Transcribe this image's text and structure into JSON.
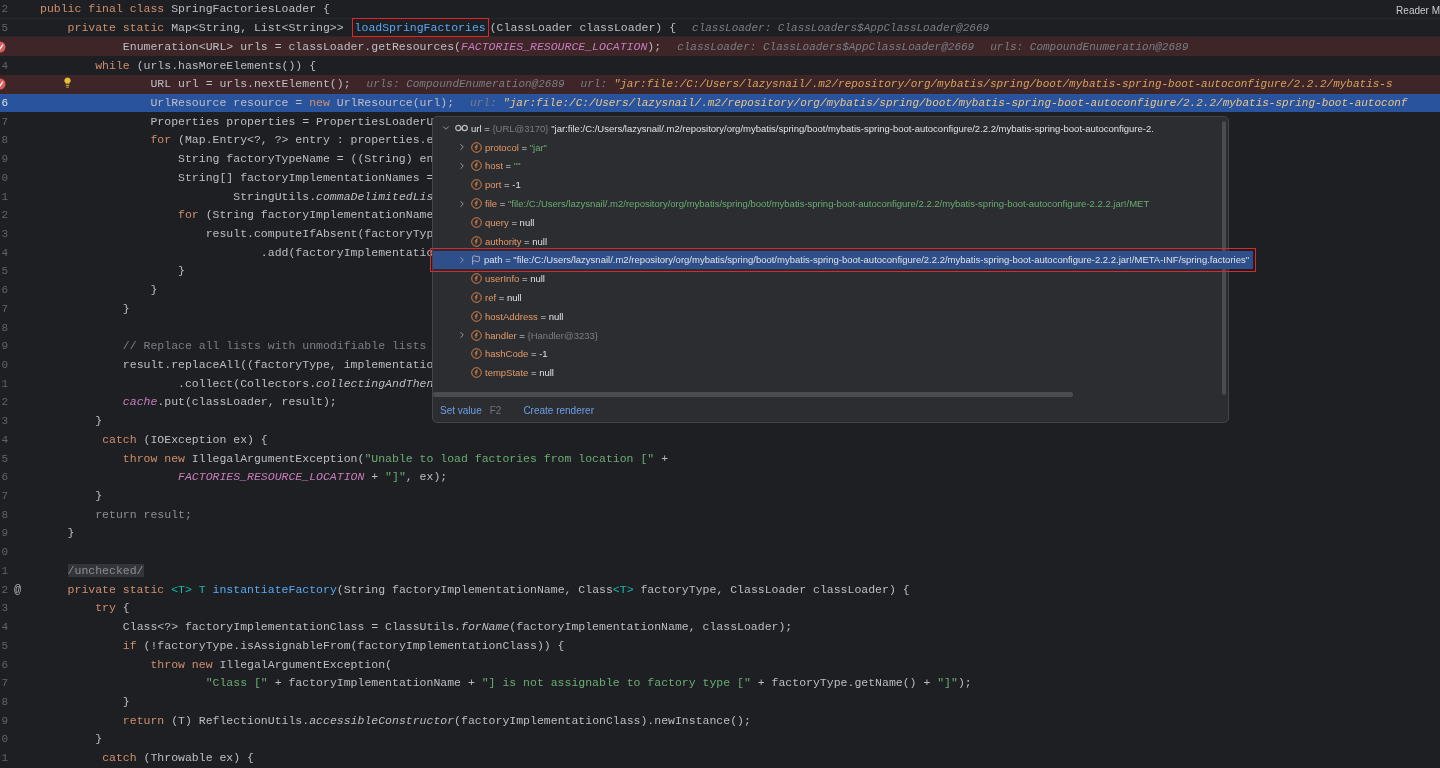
{
  "reader_mode": "Reader M",
  "lines": [
    {
      "num": "2",
      "kind": "header",
      "tokens": [
        {
          "kind": "k",
          "s": "public final class "
        },
        {
          "kind": "p",
          "s": "SpringFactoriesLoader {"
        }
      ]
    },
    {
      "num": "5",
      "kind": "header",
      "tokens": [
        {
          "kind": "k",
          "s": "    private static "
        },
        {
          "kind": "p",
          "s": "Map<String, List<String>> "
        },
        {
          "kind": "m",
          "s": "loadSpringFactories",
          "boxed": true
        },
        {
          "kind": "p",
          "s": "(ClassLoader classLoader) {"
        }
      ],
      "hints": [
        {
          "label": "classLoader: ClassLoaders$AppClassLoader@2669"
        }
      ]
    },
    {
      "kind": "breakpoint",
      "tokens": [
        {
          "kind": "p",
          "s": "            Enumeration<URL> urls = classLoader.getResources("
        },
        {
          "kind": "c",
          "s": "FACTORIES_RESOURCE_LOCATION"
        },
        {
          "kind": "p",
          "s": ");"
        }
      ],
      "hints": [
        {
          "label": "classLoader: ClassLoaders$AppClassLoader@2669"
        },
        {
          "label": "urls: CompoundEnumeration@2689"
        }
      ]
    },
    {
      "num": "4",
      "kind": "normal",
      "tokens": [
        {
          "kind": "k",
          "s": "        while "
        },
        {
          "kind": "p",
          "s": "(urls.hasMoreElements()) {"
        }
      ]
    },
    {
      "kind": "breakpoint",
      "bulb": true,
      "tokens": [
        {
          "kind": "p",
          "s": "                URL url = urls.nextElement();"
        }
      ],
      "hints": [
        {
          "label": "urls: CompoundEnumeration@2689"
        },
        {
          "label": "url: ",
          "value": "\"jar:file:/C:/Users/lazysnail/.m2/repository/org/mybatis/spring/boot/mybatis-spring-boot-autoconfigure/2.2.2/mybatis-s"
        }
      ]
    },
    {
      "num": "6",
      "kind": "current",
      "tokens": [
        {
          "kind": "p",
          "s": "                UrlResource resource = "
        },
        {
          "kind": "k",
          "s": "new "
        },
        {
          "kind": "p",
          "s": "UrlResource(url);"
        }
      ],
      "hints": [
        {
          "label": "url: ",
          "value": "\"jar:file:/C:/Users/lazysnail/.m2/repository/org/mybatis/spring/boot/mybatis-spring-boot-autoconfigure/2.2.2/mybatis-spring-boot-autoconf"
        }
      ]
    },
    {
      "num": "7",
      "kind": "normal",
      "tokens": [
        {
          "kind": "p",
          "s": "                Properties properties = PropertiesLoaderU"
        }
      ]
    },
    {
      "num": "8",
      "kind": "normal",
      "tokens": [
        {
          "kind": "k",
          "s": "                for "
        },
        {
          "kind": "p",
          "s": "(Map.Entry<?, ?> entry : properties.e"
        }
      ]
    },
    {
      "num": "9",
      "kind": "normal",
      "tokens": [
        {
          "kind": "p",
          "s": "                    String factoryTypeName = ((String) en"
        }
      ]
    },
    {
      "num": "0",
      "kind": "normal",
      "tokens": [
        {
          "kind": "p",
          "s": "                    String[] factoryImplementationNames ="
        }
      ]
    },
    {
      "num": "1",
      "kind": "normal",
      "tokens": [
        {
          "kind": "p",
          "s": "                            StringUtils."
        },
        {
          "kind": "i",
          "s": "commaDelimitedLis"
        }
      ]
    },
    {
      "num": "2",
      "kind": "normal",
      "tokens": [
        {
          "kind": "k",
          "s": "                    for "
        },
        {
          "kind": "p",
          "s": "(String factoryImplementationName"
        }
      ]
    },
    {
      "num": "3",
      "kind": "normal",
      "tokens": [
        {
          "kind": "p",
          "s": "                        result.computeIfAbsent(factoryTyp"
        }
      ]
    },
    {
      "num": "4",
      "kind": "normal",
      "tokens": [
        {
          "kind": "p",
          "s": "                                .add(factoryImplementatio"
        }
      ]
    },
    {
      "num": "5",
      "kind": "normal",
      "tokens": [
        {
          "kind": "p",
          "s": "                    }"
        }
      ]
    },
    {
      "num": "6",
      "kind": "normal",
      "tokens": [
        {
          "kind": "p",
          "s": "                }"
        }
      ]
    },
    {
      "num": "7",
      "kind": "normal",
      "tokens": [
        {
          "kind": "p",
          "s": "            }"
        }
      ]
    },
    {
      "num": "8",
      "kind": "normal"
    },
    {
      "num": "9",
      "kind": "normal",
      "tokens": [
        {
          "kind": "cm",
          "s": "            // Replace all lists with unmodifiable lists"
        }
      ]
    },
    {
      "num": "0",
      "kind": "normal",
      "tokens": [
        {
          "kind": "p",
          "s": "            result.replaceAll((factoryType, implementatio"
        }
      ]
    },
    {
      "num": "1",
      "kind": "normal",
      "tokens": [
        {
          "kind": "p",
          "s": "                    .collect(Collectors."
        },
        {
          "kind": "i",
          "s": "collectingAndThen"
        }
      ]
    },
    {
      "num": "2",
      "kind": "normal",
      "tokens": [
        {
          "kind": "f",
          "s": "            cache"
        },
        {
          "kind": "p",
          "s": ".put(classLoader, result);"
        }
      ]
    },
    {
      "num": "3",
      "kind": "normal",
      "tokens": [
        {
          "kind": "p",
          "s": "        }"
        }
      ]
    },
    {
      "num": "4",
      "kind": "normal",
      "tokens": [
        {
          "kind": "k",
          "s": "         catch "
        },
        {
          "kind": "p",
          "s": "(IOException ex) {"
        }
      ]
    },
    {
      "num": "5",
      "kind": "normal",
      "tokens": [
        {
          "kind": "k",
          "s": "            throw new "
        },
        {
          "kind": "p",
          "s": "IllegalArgumentException("
        },
        {
          "kind": "s",
          "s": "\"Unable to load factories from location [\""
        },
        {
          "kind": "p",
          "s": " +"
        }
      ]
    },
    {
      "num": "6",
      "kind": "normal",
      "tokens": [
        {
          "kind": "c",
          "s": "                    FACTORIES_RESOURCE_LOCATION"
        },
        {
          "kind": "p",
          "s": " + "
        },
        {
          "kind": "s",
          "s": "\"]\""
        },
        {
          "kind": "p",
          "s": ", ex);"
        }
      ]
    },
    {
      "num": "7",
      "kind": "normal",
      "tokens": [
        {
          "kind": "p",
          "s": "        }"
        }
      ]
    },
    {
      "num": "8",
      "kind": "normal",
      "tokens": [
        {
          "kind": "g",
          "s": "        return result;"
        }
      ]
    },
    {
      "num": "9",
      "kind": "normal",
      "tokens": [
        {
          "kind": "p",
          "s": "    }"
        }
      ]
    },
    {
      "num": "0",
      "kind": "normal"
    },
    {
      "num": "1",
      "kind": "normal",
      "tokens": [
        {
          "kind": "tag",
          "s": "    /unchecked/"
        }
      ]
    },
    {
      "num": "2",
      "kind": "normal",
      "marker": "@",
      "tokens": [
        {
          "kind": "k",
          "s": "    private static "
        },
        {
          "kind": "tp",
          "s": "<T> T "
        },
        {
          "kind": "m",
          "s": "instantiateFactory"
        },
        {
          "kind": "p",
          "s": "(String factoryImplementationName, Class"
        },
        {
          "kind": "tp",
          "s": "<T>"
        },
        {
          "kind": "p",
          "s": " factoryType, ClassLoader classLoader) {"
        }
      ]
    },
    {
      "num": "3",
      "kind": "normal",
      "tokens": [
        {
          "kind": "k",
          "s": "        try "
        },
        {
          "kind": "p",
          "s": "{"
        }
      ]
    },
    {
      "num": "4",
      "kind": "normal",
      "tokens": [
        {
          "kind": "p",
          "s": "            Class<?> factoryImplementationClass = ClassUtils."
        },
        {
          "kind": "i",
          "s": "forName"
        },
        {
          "kind": "p",
          "s": "(factoryImplementationName, classLoader);"
        }
      ]
    },
    {
      "num": "5",
      "kind": "normal",
      "tokens": [
        {
          "kind": "k",
          "s": "            if "
        },
        {
          "kind": "p",
          "s": "(!factoryType.isAssignableFrom(factoryImplementationClass)) {"
        }
      ]
    },
    {
      "num": "6",
      "kind": "normal",
      "tokens": [
        {
          "kind": "k",
          "s": "                throw new "
        },
        {
          "kind": "p",
          "s": "IllegalArgumentException("
        }
      ]
    },
    {
      "num": "7",
      "kind": "normal",
      "tokens": [
        {
          "kind": "s",
          "s": "                        \"Class [\""
        },
        {
          "kind": "p",
          "s": " + factoryImplementationName + "
        },
        {
          "kind": "s",
          "s": "\"] is not assignable to factory type [\""
        },
        {
          "kind": "p",
          "s": " + factoryType.getName() + "
        },
        {
          "kind": "s",
          "s": "\"]\""
        },
        {
          "kind": "p",
          "s": ");"
        }
      ]
    },
    {
      "num": "8",
      "kind": "normal",
      "tokens": [
        {
          "kind": "p",
          "s": "            }"
        }
      ]
    },
    {
      "num": "9",
      "kind": "normal",
      "tokens": [
        {
          "kind": "k",
          "s": "            return "
        },
        {
          "kind": "p",
          "s": "(T) ReflectionUtils."
        },
        {
          "kind": "i",
          "s": "accessibleConstructor"
        },
        {
          "kind": "p",
          "s": "(factoryImplementationClass).newInstance();"
        }
      ]
    },
    {
      "num": "0",
      "kind": "normal",
      "tokens": [
        {
          "kind": "p",
          "s": "        }"
        }
      ]
    },
    {
      "num": "1",
      "kind": "normal",
      "tokens": [
        {
          "kind": "k",
          "s": "         catch "
        },
        {
          "kind": "p",
          "s": "(Throwable ex) {"
        }
      ]
    }
  ],
  "popup": {
    "separator": "=",
    "root": {
      "name": "url",
      "ref": "{URL@3170}",
      "value": "\"jar:file:/C:/Users/lazysnail/.m2/repository/org/mybatis/spring/boot/mybatis-spring-boot-autoconfigure/2.2.2/mybatis-spring-boot-autoconfigure-2.",
      "expanded": true
    },
    "children": [
      {
        "name": "protocol",
        "value": "\"jar\"",
        "kind": "string",
        "expandable": true,
        "selected": false
      },
      {
        "name": "host",
        "value": "\"\"",
        "kind": "string",
        "expandable": true,
        "selected": false
      },
      {
        "name": "port",
        "value": "-1",
        "kind": "plain",
        "expandable": false,
        "selected": false
      },
      {
        "name": "file",
        "value": "\"file:/C:/Users/lazysnail/.m2/repository/org/mybatis/spring/boot/mybatis-spring-boot-autoconfigure/2.2.2/mybatis-spring-boot-autoconfigure-2.2.2.jar!/MET",
        "kind": "string",
        "expandable": true,
        "selected": false
      },
      {
        "name": "query",
        "value": "null",
        "kind": "plain",
        "expandable": false,
        "selected": false
      },
      {
        "name": "authority",
        "value": "null",
        "kind": "plain",
        "expandable": false,
        "selected": false
      },
      {
        "name": "path",
        "value": "\"file:/C:/Users/lazysnail/.m2/repository/org/mybatis/spring/boot/mybatis-spring-boot-autoconfigure/2.2.2/mybatis-spring-boot-autoconfigure-2.2.2.jar!/META-INF/spring.factories\"",
        "kind": "plain",
        "expandable": true,
        "selected": true,
        "boxed": true
      },
      {
        "name": "userInfo",
        "value": "null",
        "kind": "plain",
        "expandable": false,
        "selected": false
      },
      {
        "name": "ref",
        "value": "null",
        "kind": "plain",
        "expandable": false,
        "selected": false
      },
      {
        "name": "hostAddress",
        "value": "null",
        "kind": "plain",
        "expandable": false,
        "selected": false
      },
      {
        "name": "handler",
        "value": "{Handler@3233}",
        "kind": "ref",
        "expandable": true,
        "selected": false
      },
      {
        "name": "hashCode",
        "value": "-1",
        "kind": "plain",
        "expandable": false,
        "selected": false
      },
      {
        "name": "tempState",
        "value": "null",
        "kind": "plain",
        "expandable": false,
        "selected": false
      }
    ],
    "footer": [
      {
        "label": "Set value",
        "shortcut": "F2"
      },
      {
        "label": "Create renderer"
      }
    ]
  }
}
